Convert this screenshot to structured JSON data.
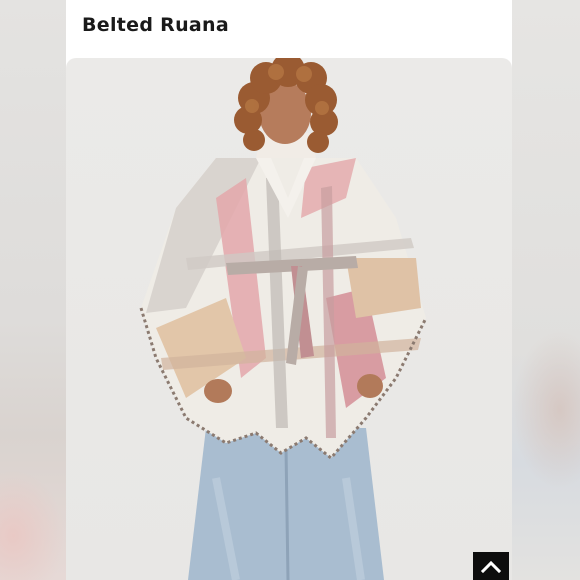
{
  "listing": {
    "title": "Belted Ruana"
  },
  "product_image": {
    "description_icon": "product-photo"
  },
  "scroll_top_button": {
    "icon": "chevron-up-icon"
  },
  "colors": {
    "background": "#e9e8e6",
    "card": "#ffffff",
    "title_text": "#1a1a1a",
    "button": "#0d0d0d"
  }
}
